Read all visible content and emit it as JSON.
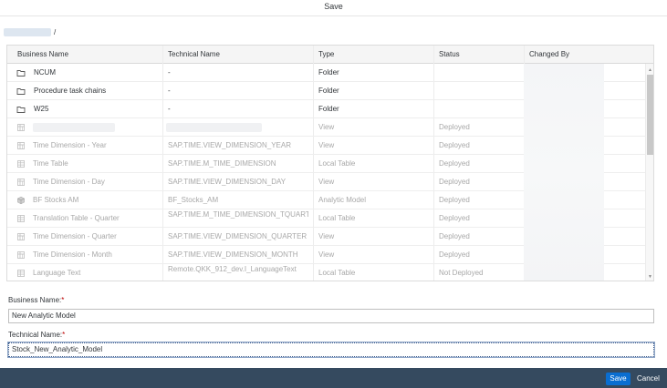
{
  "dialog": {
    "title": "Save"
  },
  "breadcrumb": {
    "separator": "/"
  },
  "table": {
    "headers": {
      "business_name": "Business Name",
      "technical_name": "Technical Name",
      "type": "Type",
      "status": "Status",
      "changed_by": "Changed By"
    },
    "rows": [
      {
        "icon": "folder-icon",
        "business_name": "NCUM",
        "technical_name": "-",
        "type": "Folder",
        "status": ""
      },
      {
        "icon": "folder-icon",
        "business_name": "Procedure task chains",
        "technical_name": "-",
        "type": "Folder",
        "status": ""
      },
      {
        "icon": "folder-icon",
        "business_name": "W25",
        "technical_name": "-",
        "type": "Folder",
        "status": ""
      },
      {
        "icon": "view-icon",
        "business_name": "",
        "technical_name": "",
        "type": "View",
        "status": "Deployed"
      },
      {
        "icon": "view-icon",
        "business_name": "Time Dimension - Year",
        "technical_name": "SAP.TIME.VIEW_DIMENSION_YEAR",
        "type": "View",
        "status": "Deployed"
      },
      {
        "icon": "table-icon",
        "business_name": "Time Table",
        "technical_name": "SAP.TIME.M_TIME_DIMENSION",
        "type": "Local Table",
        "status": "Deployed"
      },
      {
        "icon": "view-icon",
        "business_name": "Time Dimension - Day",
        "technical_name": "SAP.TIME.VIEW_DIMENSION_DAY",
        "type": "View",
        "status": "Deployed"
      },
      {
        "icon": "cube-icon",
        "business_name": "BF Stocks AM",
        "technical_name": "BF_Stocks_AM",
        "type": "Analytic Model",
        "status": "Deployed"
      },
      {
        "icon": "table-icon",
        "business_name": "Translation Table - Quarter",
        "technical_name": "SAP.TIME.M_TIME_DIMENSION_TQUARTER",
        "type": "Local Table",
        "status": "Deployed"
      },
      {
        "icon": "view-icon",
        "business_name": "Time Dimension - Quarter",
        "technical_name": "SAP.TIME.VIEW_DIMENSION_QUARTER",
        "type": "View",
        "status": "Deployed"
      },
      {
        "icon": "view-icon",
        "business_name": "Time Dimension - Month",
        "technical_name": "SAP.TIME.VIEW_DIMENSION_MONTH",
        "type": "View",
        "status": "Deployed"
      },
      {
        "icon": "table-icon",
        "business_name": "Language Text",
        "technical_name": "Remote.QKK_912_dev.I_LanguageText",
        "type": "Local Table",
        "status": "Not Deployed"
      }
    ]
  },
  "form": {
    "business_name_label": "Business Name:",
    "business_name_value": "New Analytic Model",
    "technical_name_label": "Technical Name:",
    "technical_name_value": "Stock_New_Analytic_Model",
    "required_marker": "*"
  },
  "footer": {
    "save_label": "Save",
    "cancel_label": "Cancel"
  },
  "colors": {
    "accent": "#0a6ed1",
    "footer_bg": "#354a5f",
    "required": "#bb0000",
    "disabled_text": "#a8a8a8"
  }
}
